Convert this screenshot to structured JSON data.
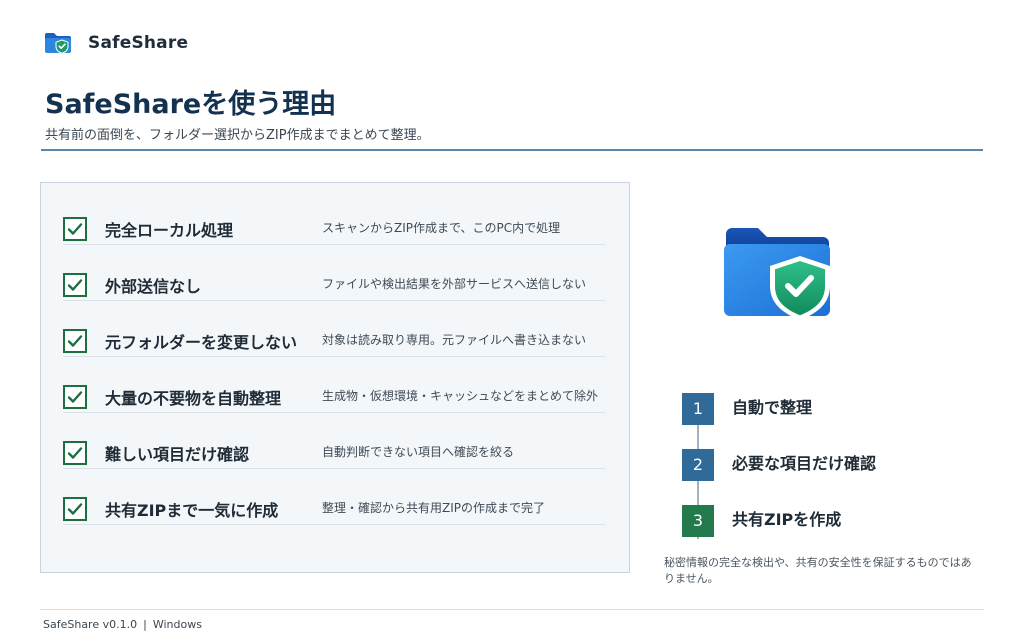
{
  "app": {
    "name": "SafeShare"
  },
  "header": {
    "title": "SafeShareを使う理由",
    "subtitle": "共有前の面倒を、フォルダー選択からZIP作成までまとめて整理。"
  },
  "features": [
    {
      "title": "完全ローカル処理",
      "description": "スキャンからZIP作成まで、このPC内で処理",
      "checked": true
    },
    {
      "title": "外部送信なし",
      "description": "ファイルや検出結果を外部サービスへ送信しない",
      "checked": true
    },
    {
      "title": "元フォルダーを変更しない",
      "description": "対象は読み取り専用。元ファイルへ書き込まない",
      "checked": true
    },
    {
      "title": "大量の不要物を自動整理",
      "description": "生成物・仮想環境・キャッシュなどをまとめて除外",
      "checked": true
    },
    {
      "title": "難しい項目だけ確認",
      "description": "自動判断できない項目へ確認を絞る",
      "checked": true
    },
    {
      "title": "共有ZIPまで一気に作成",
      "description": "整理・確認から共有用ZIPの作成まで完了",
      "checked": true
    }
  ],
  "hero": {
    "icon": "folder-shield-icon"
  },
  "steps": [
    {
      "number": "1",
      "label": "自動で整理",
      "color": "#2f6a99"
    },
    {
      "number": "2",
      "label": "必要な項目だけ確認",
      "color": "#2f6a99"
    },
    {
      "number": "3",
      "label": "共有ZIPを作成",
      "color": "#237a4d"
    }
  ],
  "disclaimer": "秘密情報の完全な検出や、共有の安全性を保証するものではありません。",
  "footer": {
    "version": "SafeShare v0.1.0",
    "separator": "|",
    "platform": "Windows"
  },
  "colors": {
    "accent_blue": "#2f6a99",
    "accent_green": "#237a4d",
    "check_green": "#1e6f3f",
    "title_navy": "#13324f"
  }
}
